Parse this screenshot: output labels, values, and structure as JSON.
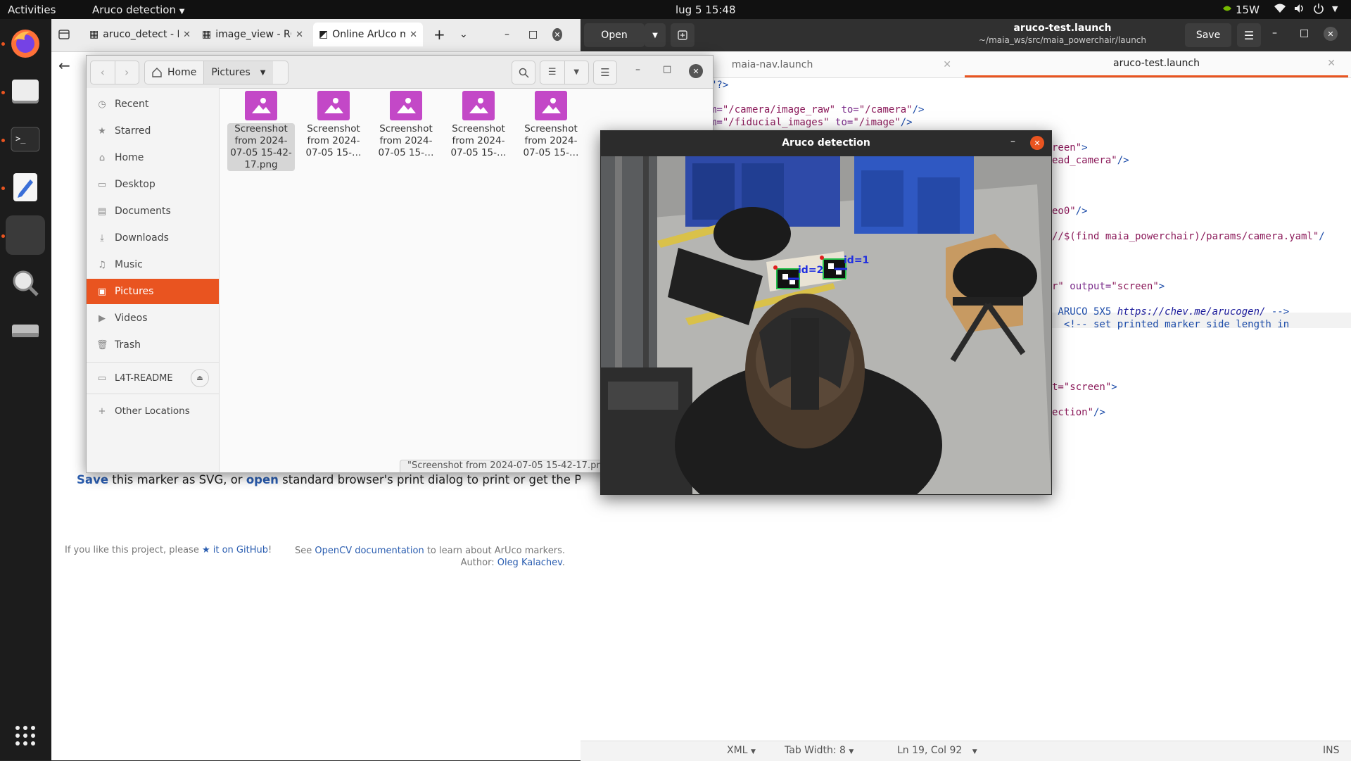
{
  "topbar": {
    "activities": "Activities",
    "app_menu": "Aruco detection",
    "clock": "lug 5  15:48",
    "power_label": "15W"
  },
  "browser": {
    "tabs": [
      {
        "label": "aruco_detect - R"
      },
      {
        "label": "image_view - RO"
      },
      {
        "label": "Online ArUco m"
      }
    ],
    "page": {
      "save_link": "Save",
      "sentence_a": " this marker as SVG, or ",
      "open_link": "open",
      "sentence_b": " standard browser's print dialog to print or get the PDF.",
      "like_a": "If you like this project, please ",
      "star_link": "★ it on GitHub",
      "like_b": "!",
      "see_a": "See ",
      "opencv_link": "OpenCV documentation",
      "see_b": " to learn about ArUco markers.",
      "author_a": "Author: ",
      "author_link": "Oleg Kalachev",
      "author_b": "."
    }
  },
  "editor": {
    "open_label": "Open",
    "title": "aruco-test.launch",
    "path": "~/maia_ws/src/maia_powerchair/launch",
    "save_label": "Save",
    "tabs": [
      {
        "label": "maia-nav.launch"
      },
      {
        "label": "aruco-test.launch"
      }
    ],
    "status": {
      "language": "XML",
      "tab_width": "Tab Width: 8",
      "position": "Ln 19, Col 92",
      "mode": "INS"
    }
  },
  "files": {
    "breadcrumb_home": "Home",
    "breadcrumb_current": "Pictures",
    "sidebar": [
      {
        "label": "Recent",
        "icon": "clock-icon"
      },
      {
        "label": "Starred",
        "icon": "star-icon"
      },
      {
        "label": "Home",
        "icon": "home-icon"
      },
      {
        "label": "Desktop",
        "icon": "desktop-icon"
      },
      {
        "label": "Documents",
        "icon": "document-icon"
      },
      {
        "label": "Downloads",
        "icon": "download-icon"
      },
      {
        "label": "Music",
        "icon": "music-icon"
      },
      {
        "label": "Pictures",
        "icon": "picture-icon"
      },
      {
        "label": "Videos",
        "icon": "video-icon"
      },
      {
        "label": "Trash",
        "icon": "trash-icon"
      }
    ],
    "drive_label": "L4T-README",
    "other_locations": "Other Locations",
    "items": [
      {
        "line1": "Screenshot",
        "line2": "from 2024-",
        "line3": "07-05 15-42-",
        "line4": "17.png"
      },
      {
        "line1": "Screenshot",
        "line2": "from 2024-",
        "line3": "07-05 15-…",
        "line4": ""
      },
      {
        "line1": "Screenshot",
        "line2": "from 2024-",
        "line3": "07-05 15-…",
        "line4": ""
      },
      {
        "line1": "Screenshot",
        "line2": "from 2024-",
        "line3": "07-05 15-…",
        "line4": ""
      },
      {
        "line1": "Screenshot",
        "line2": "from 2024-",
        "line3": "07-05 15-…",
        "line4": ""
      }
    ],
    "status_label": "\"Screenshot from 2024-07-05 15-42-17.pn"
  },
  "aruco_window": {
    "title": "Aruco detection",
    "marker_labels": [
      "id=2",
      "id=1"
    ]
  },
  "colors": {
    "accent": "#e95420",
    "link": "#2a5db0",
    "thumb": "#c348c7"
  }
}
